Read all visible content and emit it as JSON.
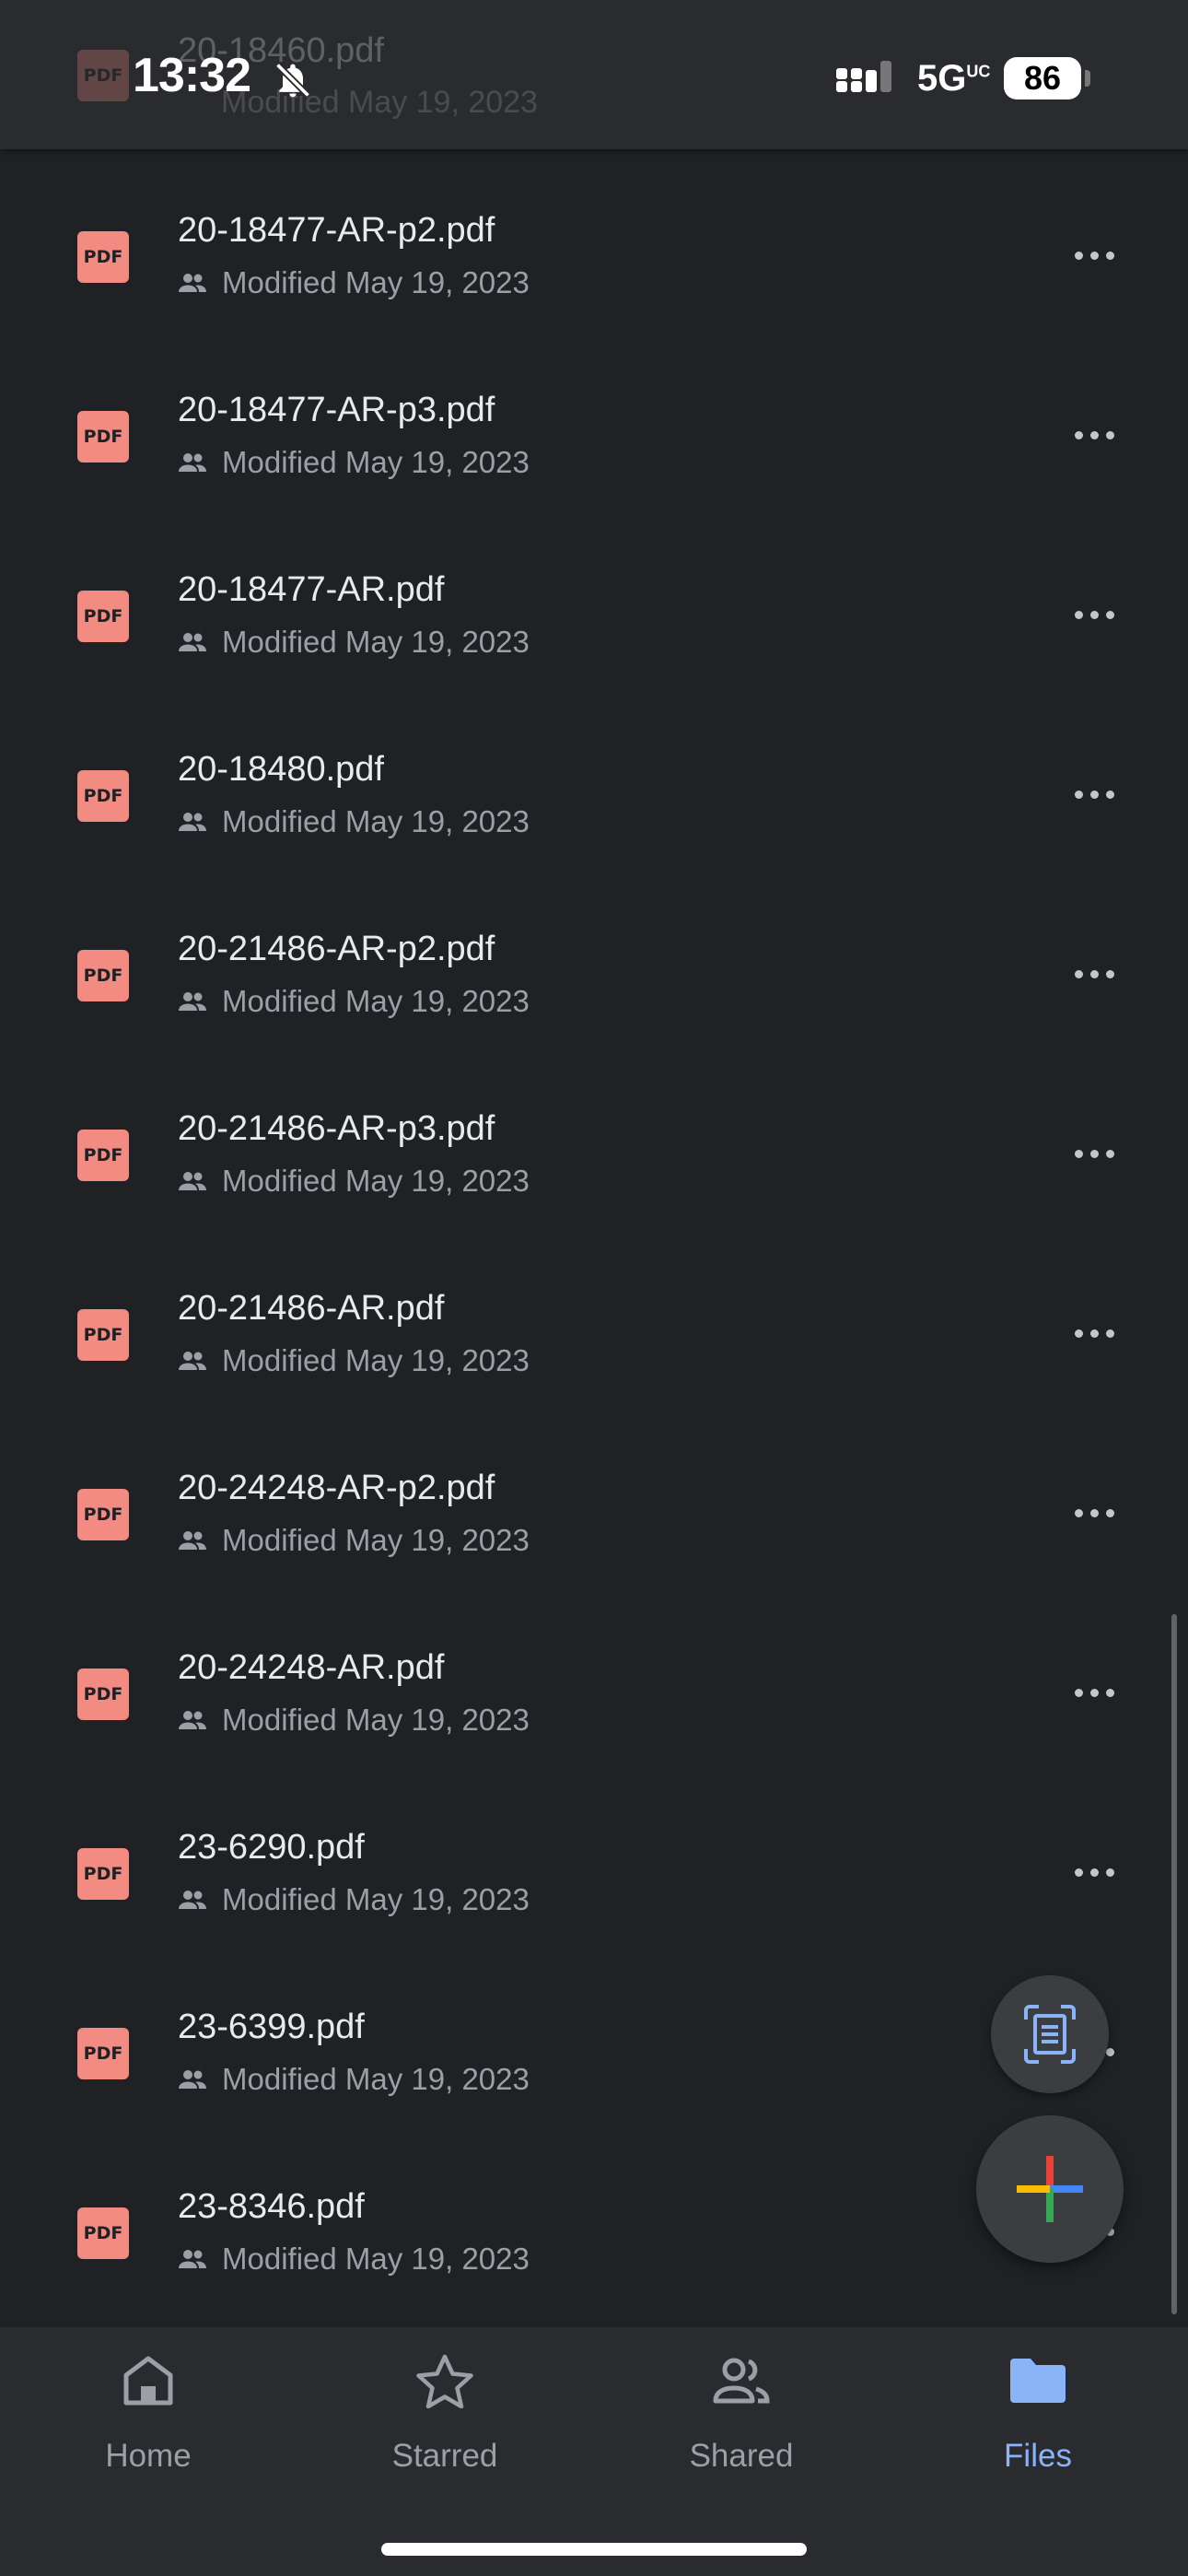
{
  "status_bar": {
    "time": "13:32",
    "network": "5G",
    "network_suffix": "UC",
    "battery": "86"
  },
  "ghost_row": {
    "name": "20-18460.pdf",
    "meta": "Modified May 19, 2023"
  },
  "file_badge_label": "PDF",
  "files": [
    {
      "name": "20-18477-AR-p2.pdf",
      "modified": "Modified May 19, 2023"
    },
    {
      "name": "20-18477-AR-p3.pdf",
      "modified": "Modified May 19, 2023"
    },
    {
      "name": "20-18477-AR.pdf",
      "modified": "Modified May 19, 2023"
    },
    {
      "name": "20-18480.pdf",
      "modified": "Modified May 19, 2023"
    },
    {
      "name": "20-21486-AR-p2.pdf",
      "modified": "Modified May 19, 2023"
    },
    {
      "name": "20-21486-AR-p3.pdf",
      "modified": "Modified May 19, 2023"
    },
    {
      "name": "20-21486-AR.pdf",
      "modified": "Modified May 19, 2023"
    },
    {
      "name": "20-24248-AR-p2.pdf",
      "modified": "Modified May 19, 2023"
    },
    {
      "name": "20-24248-AR.pdf",
      "modified": "Modified May 19, 2023"
    },
    {
      "name": "23-6290.pdf",
      "modified": "Modified May 19, 2023"
    },
    {
      "name": "23-6399.pdf",
      "modified": "Modified May 19, 2023"
    },
    {
      "name": "23-8346.pdf",
      "modified": "Modified May 19, 2023"
    }
  ],
  "nav": {
    "home": "Home",
    "starred": "Starred",
    "shared": "Shared",
    "files": "Files",
    "active": "files"
  },
  "colors": {
    "background": "#202124",
    "pdf_badge": "#f28b82",
    "accent": "#8ab4f8",
    "google_blue": "#4285f4",
    "google_red": "#ea4335",
    "google_yellow": "#fbbc04",
    "google_green": "#34a853"
  },
  "icons": {
    "row_shared": "people-icon",
    "row_more": "more-horiz-icon",
    "scan": "document-scan-icon",
    "new": "plus-icon",
    "status_silent": "bell-off-icon"
  }
}
